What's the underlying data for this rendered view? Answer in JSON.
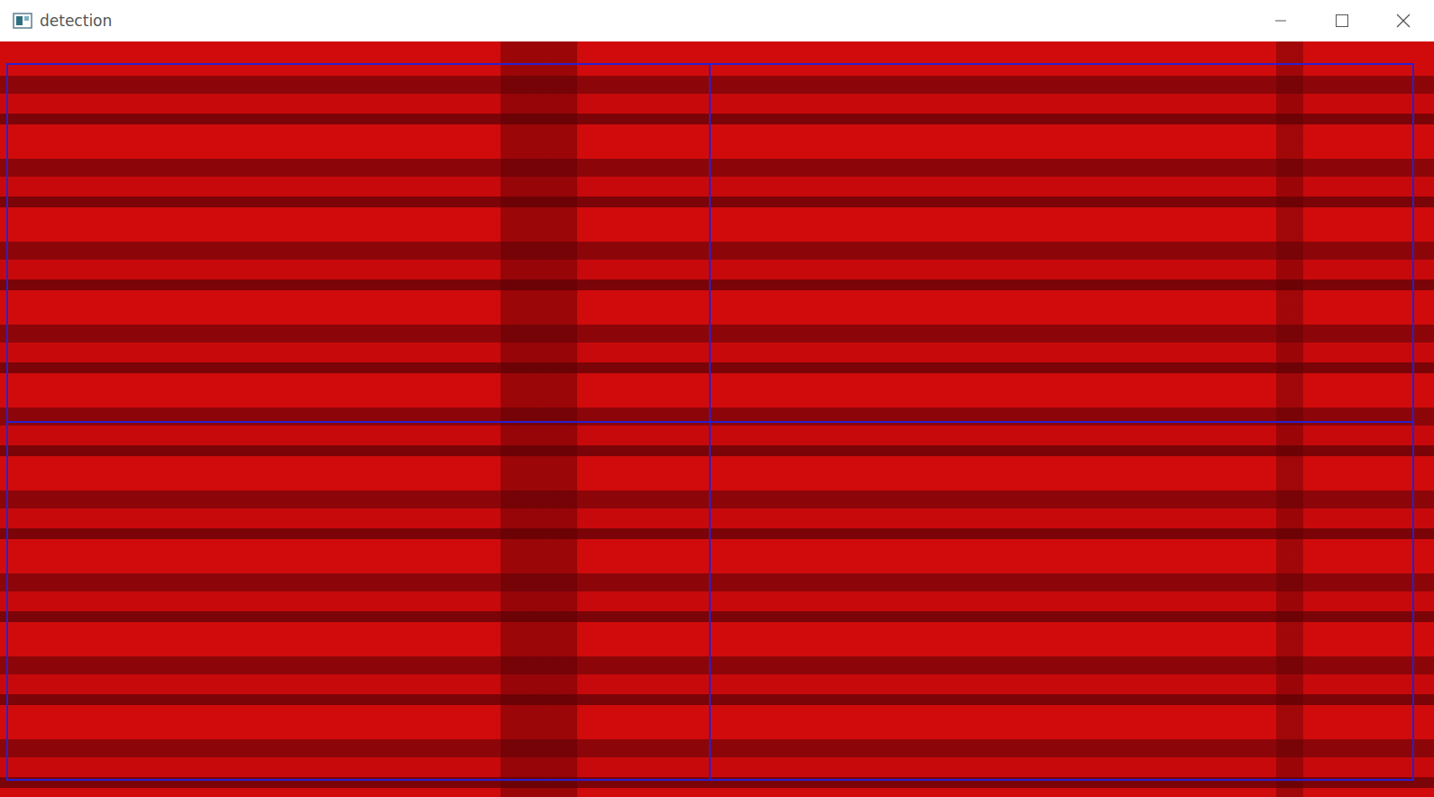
{
  "window": {
    "title": "detection"
  }
}
